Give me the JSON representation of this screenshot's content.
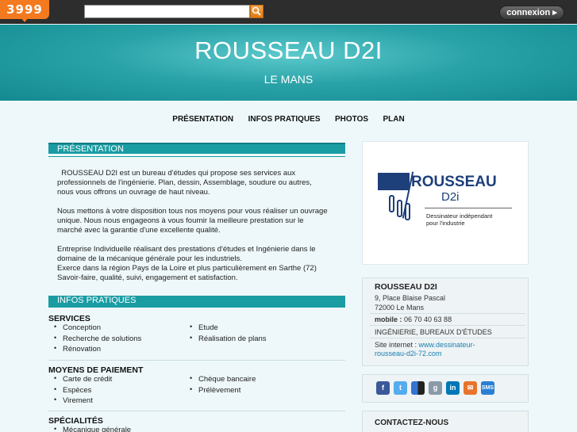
{
  "topbar": {
    "logo_text": "3999",
    "search_placeholder": "",
    "connexion_label": "connexion ▸"
  },
  "header": {
    "title": "ROUSSEAU D2I",
    "city": "LE MANS"
  },
  "nav": {
    "items": [
      "PRÉSENTATION",
      "INFOS PRATIQUES",
      "PHOTOS",
      "PLAN"
    ]
  },
  "presentation": {
    "heading": "PRÉSENTATION",
    "lines": [
      "  ROUSSEAU D2I est un bureau d'études qui propose ses services aux",
      "professionnels de l'ingénierie. Plan, dessin, Assemblage, soudure ou autres,",
      "nous vous offrons un ouvrage de haut niveau.",
      "",
      "Nous mettons à votre disposition tous nos moyens pour vous réaliser un ouvrage",
      "unique. Nous nous engageons à vous fournir la meilleure prestation sur le",
      "marché avec la garantie d'une excellente qualité.",
      "",
      "Entreprise Individuelle réalisant des prestations d'études et Ingénierie dans le",
      "domaine de la mécanique générale pour les industriels.",
      "Exerce dans la région Pays de la Loire et plus particulièrement en Sarthe (72)",
      "Savoir-faire, qualité, suivi, engagement et satisfaction."
    ]
  },
  "infos": {
    "heading": "INFOS PRATIQUES",
    "services_title": "SERVICES",
    "services_col1": [
      "Conception",
      "Recherche de solutions",
      "Rénovation"
    ],
    "services_col2": [
      "Etude",
      "Réalisation de plans"
    ],
    "payment_title": "MOYENS DE PAIEMENT",
    "payment_col1": [
      "Carte de crédit",
      "Espèces",
      "Virement"
    ],
    "payment_col2": [
      "Chèque bancaire",
      "Prélèvement"
    ],
    "specialites_title": "SPÉCIALITÉS",
    "specialites_col1": [
      "Mécanique générale"
    ]
  },
  "brand": {
    "name": "ROUSSEAU",
    "sub": "D2i",
    "tagline_1": "Dessinateur indépendant",
    "tagline_2": "pour l'industrie"
  },
  "infobox": {
    "title": "ROUSSEAU D2I",
    "address_1": "9, Place Blaise Pascal",
    "address_2": "72000 Le Mans",
    "mobile_label": "mobile : ",
    "mobile_value": "06 70 40 63 88",
    "category": "INGÉNIERIE, BUREAUX D'ÉTUDES",
    "site_label": "Site internet : ",
    "site_url_1": "www.dessinateur-",
    "site_url_2": "rousseau-d2i-72.com"
  },
  "social": {
    "icons": [
      "facebook-icon",
      "twitter-icon",
      "delicious-icon",
      "google-icon",
      "linkedin-icon",
      "email-icon",
      "sms-icon"
    ],
    "labels": [
      "f",
      "t",
      "",
      "g",
      "in",
      "✉",
      "SMS"
    ],
    "colors": [
      "#3b5998",
      "#55acee",
      "#3274d1",
      "#8a9aa8",
      "#0077b5",
      "#e8742a",
      "#2a7fd4"
    ]
  },
  "contact": {
    "title": "CONTACTEZ-NOUS"
  }
}
